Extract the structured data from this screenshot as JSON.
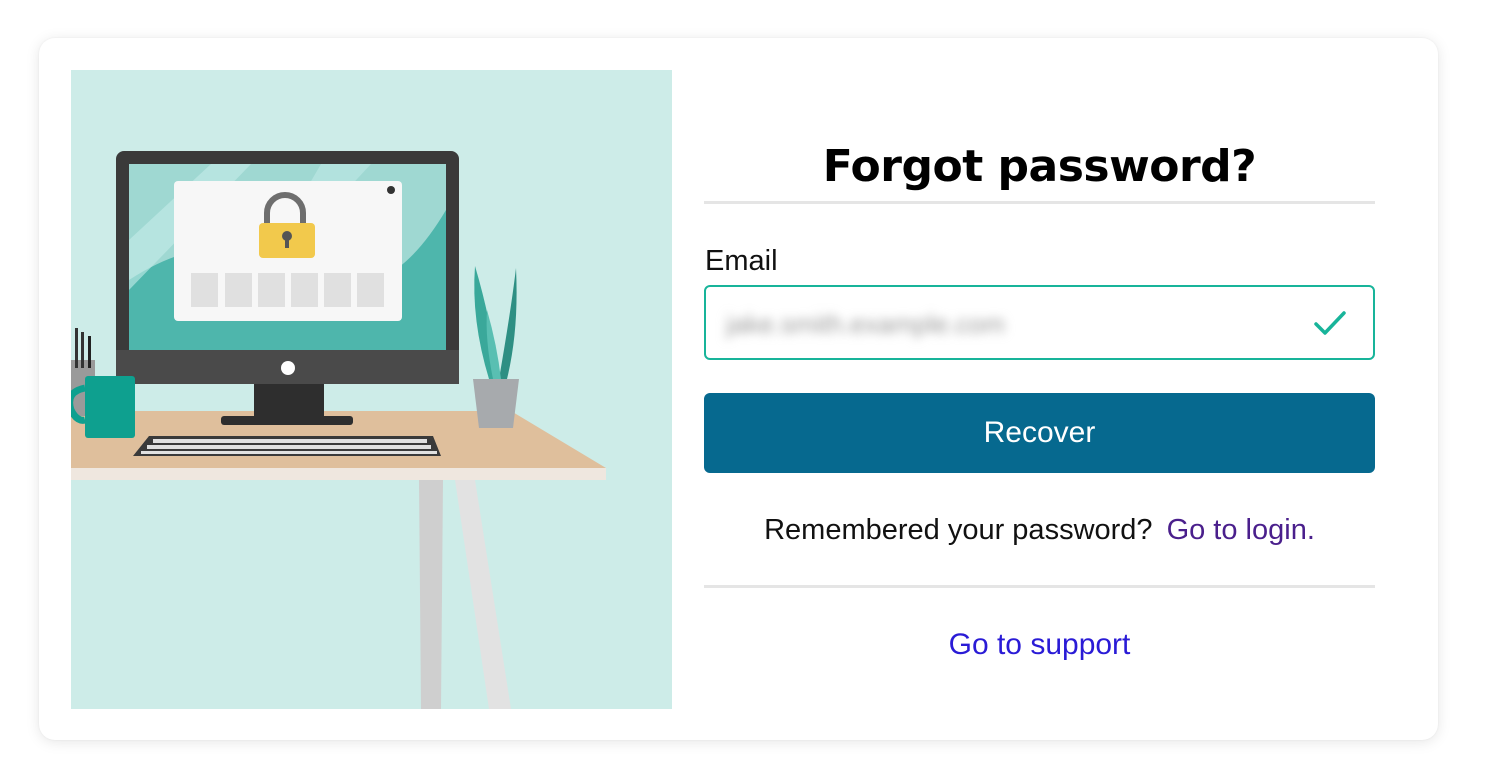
{
  "page": {
    "title": "Forgot password?"
  },
  "form": {
    "email_label": "Email",
    "email_value": "jake.smith.example.com",
    "email_valid": true,
    "recover_label": "Recover",
    "remembered_text": "Remembered your password?",
    "login_link": "Go to login.",
    "support_link": "Go to support"
  },
  "colors": {
    "button": "#06698f",
    "field_border": "#18b49a",
    "check": "#18b49a",
    "login_link": "#4a1f8c",
    "support_link": "#2a1bd6",
    "illustration_bg": "#cdece8"
  },
  "illustration": {
    "description_icon": "desk-computer-lock-illustration"
  }
}
